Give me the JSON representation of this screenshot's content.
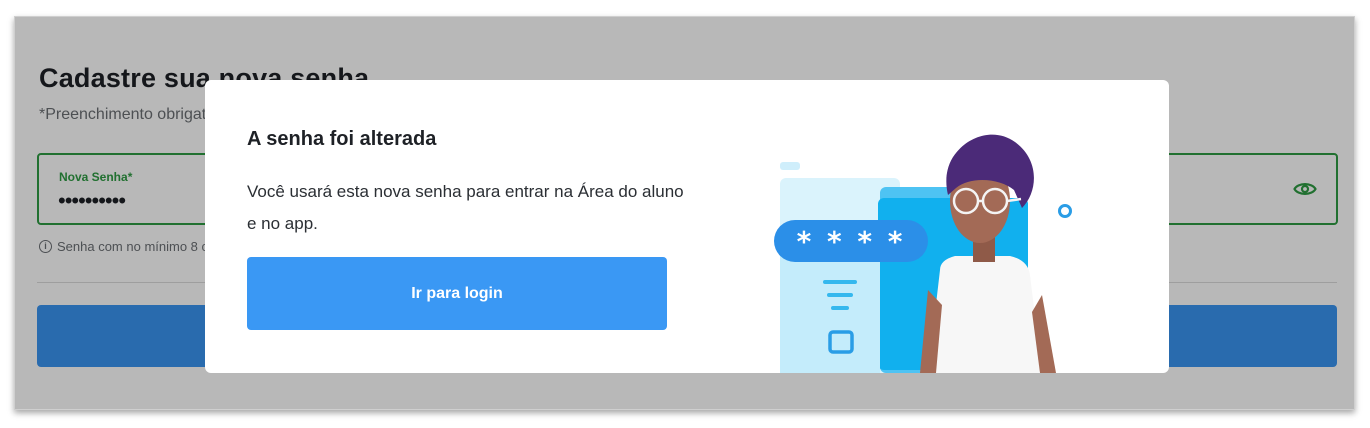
{
  "page": {
    "title": "Cadastre sua nova senha",
    "required_note": "*Preenchimento obrigatório",
    "password_field": {
      "label": "Nova Senha*",
      "value": "••••••••••"
    },
    "hint": "Senha com no mínimo 8 caracteres",
    "hint_icon": "info-icon",
    "eye_icon": "eye-icon",
    "accent_green": "#2e9b43",
    "button_color": "#3a95f2"
  },
  "modal": {
    "title": "A senha foi alterada",
    "message": "Você usará esta nova senha para entrar na Área do aluno e no app.",
    "button_label": "Ir para login",
    "button_color": "#3a98f4",
    "illustration": {
      "bubble_text": "* * * *",
      "icon": "person-with-password-illustration"
    }
  }
}
